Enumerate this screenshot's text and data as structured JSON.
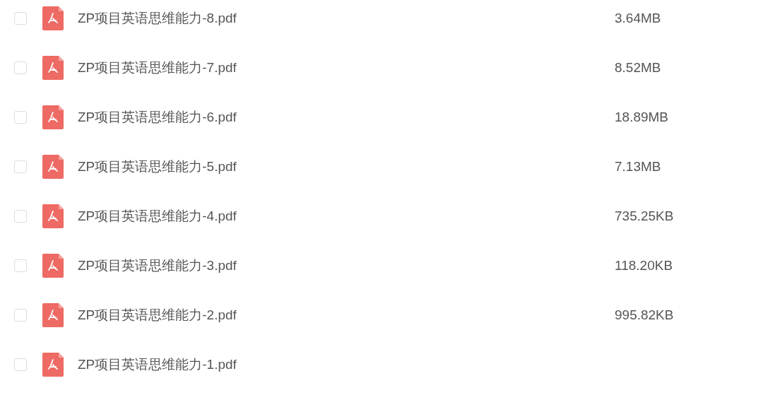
{
  "files": [
    {
      "name": "ZP项目英语思维能力-8.pdf",
      "size": "3.64MB",
      "checked": false
    },
    {
      "name": "ZP项目英语思维能力-7.pdf",
      "size": "8.52MB",
      "checked": false
    },
    {
      "name": "ZP项目英语思维能力-6.pdf",
      "size": "18.89MB",
      "checked": false
    },
    {
      "name": "ZP项目英语思维能力-5.pdf",
      "size": "7.13MB",
      "checked": false
    },
    {
      "name": "ZP项目英语思维能力-4.pdf",
      "size": "735.25KB",
      "checked": false
    },
    {
      "name": "ZP项目英语思维能力-3.pdf",
      "size": "118.20KB",
      "checked": false
    },
    {
      "name": "ZP项目英语思维能力-2.pdf",
      "size": "995.82KB",
      "checked": false
    },
    {
      "name": "ZP项目英语思维能力-1.pdf",
      "checked": false
    }
  ]
}
